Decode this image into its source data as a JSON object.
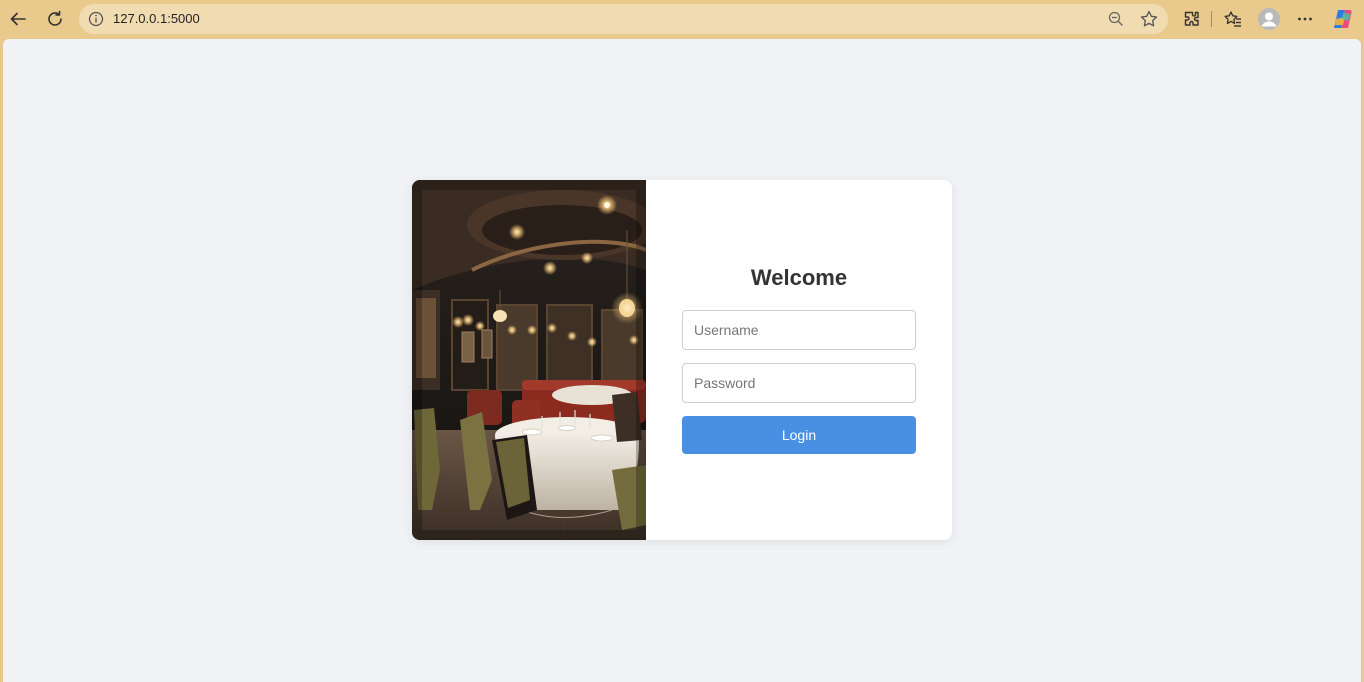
{
  "browser": {
    "url": "127.0.0.1:5000",
    "icons": [
      "back-arrow-icon",
      "refresh-icon",
      "info-icon",
      "zoom-out-icon",
      "favorite-star-icon",
      "extensions-icon",
      "favorites-list-icon",
      "profile-avatar-icon",
      "more-menu-icon",
      "copilot-icon"
    ]
  },
  "login": {
    "title": "Welcome",
    "username_placeholder": "Username",
    "password_placeholder": "Password",
    "button_label": "Login",
    "accent_color": "#4a90e2"
  },
  "colors": {
    "page_bg": "#f0f2f5",
    "chrome_bg": "#eac98c"
  }
}
